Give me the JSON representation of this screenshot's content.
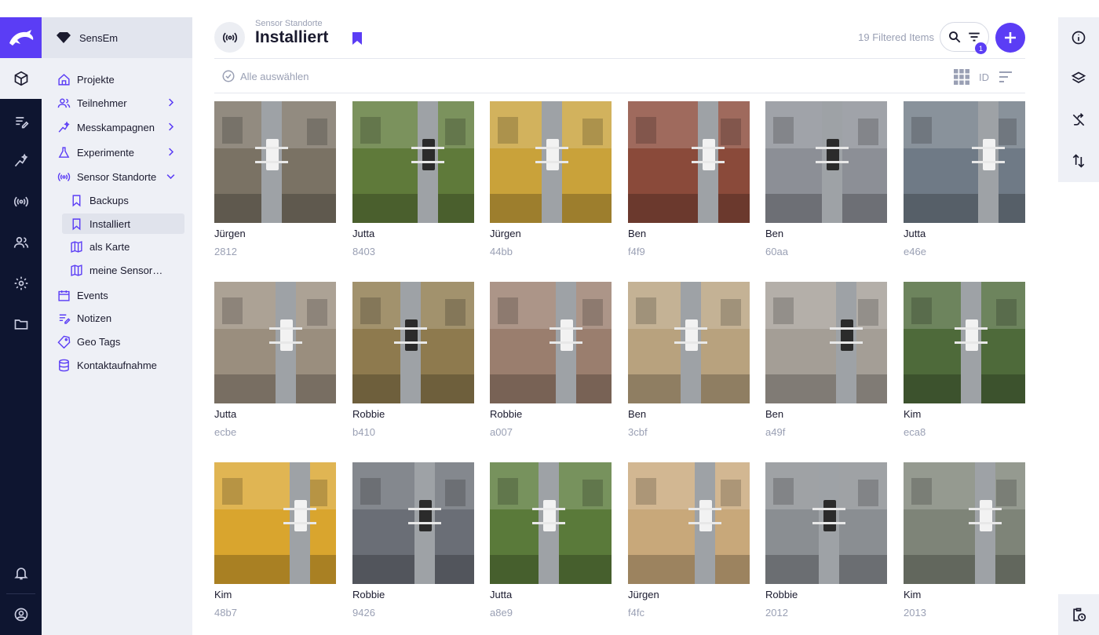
{
  "app": {
    "brand": "SensEm",
    "accent": "#5b3df5"
  },
  "sidebar": {
    "items": [
      {
        "label": "Projekte",
        "icon": "home-icon",
        "chevron": false
      },
      {
        "label": "Teilnehmer",
        "icon": "users-icon",
        "chevron": "right"
      },
      {
        "label": "Messkampagnen",
        "icon": "sparkle-icon",
        "chevron": "right"
      },
      {
        "label": "Experimente",
        "icon": "flask-icon",
        "chevron": "right"
      },
      {
        "label": "Sensor Standorte",
        "icon": "sensor-icon",
        "chevron": "down"
      },
      {
        "label": "Backups",
        "icon": "bookmark-icon",
        "sub": true
      },
      {
        "label": "Installiert",
        "icon": "bookmark-icon",
        "sub": true,
        "selected": true
      },
      {
        "label": "als Karte",
        "icon": "map-icon",
        "sub": true
      },
      {
        "label": "meine Sensorstandorte",
        "icon": "map-icon",
        "sub": true
      },
      {
        "label": "Events",
        "icon": "calendar-icon",
        "chevron": false
      },
      {
        "label": "Notizen",
        "icon": "notes-icon",
        "chevron": false
      },
      {
        "label": "Geo Tags",
        "icon": "tag-icon",
        "chevron": false
      },
      {
        "label": "Kontaktaufnahme",
        "icon": "database-icon",
        "chevron": false
      }
    ]
  },
  "header": {
    "breadcrumb": "Sensor Standorte",
    "title": "Installiert",
    "filtered": "19 Filtered Items",
    "filter_badge": "1"
  },
  "toolbar": {
    "select_all": "Alle auswählen",
    "sort_field": "ID"
  },
  "items": [
    {
      "name": "Jürgen",
      "id": "2812",
      "scene": "#7a7264"
    },
    {
      "name": "Jutta",
      "id": "8403",
      "scene": "#5f7a3a"
    },
    {
      "name": "Jürgen",
      "id": "44bb",
      "scene": "#c9a23a"
    },
    {
      "name": "Ben",
      "id": "f4f9",
      "scene": "#8a4a3a"
    },
    {
      "name": "Ben",
      "id": "60aa",
      "scene": "#8c8f96"
    },
    {
      "name": "Jutta",
      "id": "e46e",
      "scene": "#6f7a86"
    },
    {
      "name": "Jutta",
      "id": "ecbe",
      "scene": "#9a8e7e"
    },
    {
      "name": "Robbie",
      "id": "b410",
      "scene": "#8e7a4e"
    },
    {
      "name": "Robbie",
      "id": "a007",
      "scene": "#9a7e6e"
    },
    {
      "name": "Ben",
      "id": "3cbf",
      "scene": "#b8a27e"
    },
    {
      "name": "Ben",
      "id": "a49f",
      "scene": "#a49e96"
    },
    {
      "name": "Kim",
      "id": "eca8",
      "scene": "#4e6a3a"
    },
    {
      "name": "Kim",
      "id": "48b7",
      "scene": "#d9a52e"
    },
    {
      "name": "Robbie",
      "id": "9426",
      "scene": "#6a6e76"
    },
    {
      "name": "Jutta",
      "id": "a8e9",
      "scene": "#5a7a3a"
    },
    {
      "name": "Jürgen",
      "id": "f4fc",
      "scene": "#c8a87a"
    },
    {
      "name": "Robbie",
      "id": "2012",
      "scene": "#8a8e92"
    },
    {
      "name": "Kim",
      "id": "2013",
      "scene": "#7e8478"
    }
  ]
}
